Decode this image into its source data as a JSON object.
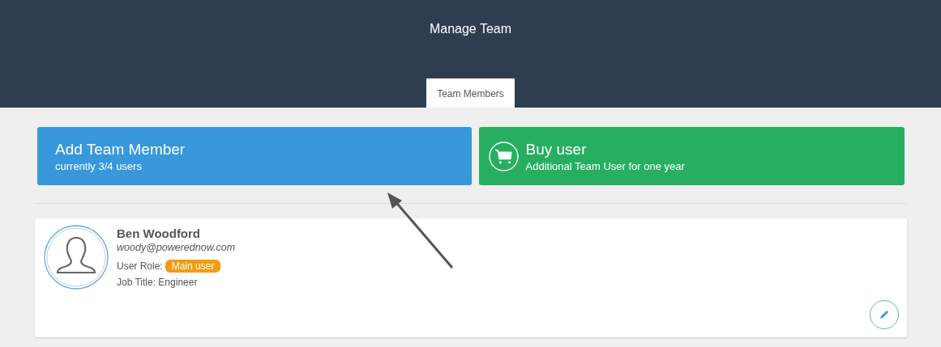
{
  "header": {
    "title": "Manage Team"
  },
  "tabs": [
    {
      "label": "Team Members",
      "selected": true
    }
  ],
  "actions": [
    {
      "kind": "add",
      "title": "Add Team Member",
      "subtitle": "currently 3/4 users"
    },
    {
      "kind": "buy",
      "title": "Buy user",
      "subtitle": "Additional Team User for one year"
    }
  ],
  "members": [
    {
      "name": "Ben Woodford",
      "email": "woody@powerednow.com",
      "role_label": "User Role:",
      "role": "Main user",
      "job_title": "Job Title: Engineer"
    }
  ]
}
